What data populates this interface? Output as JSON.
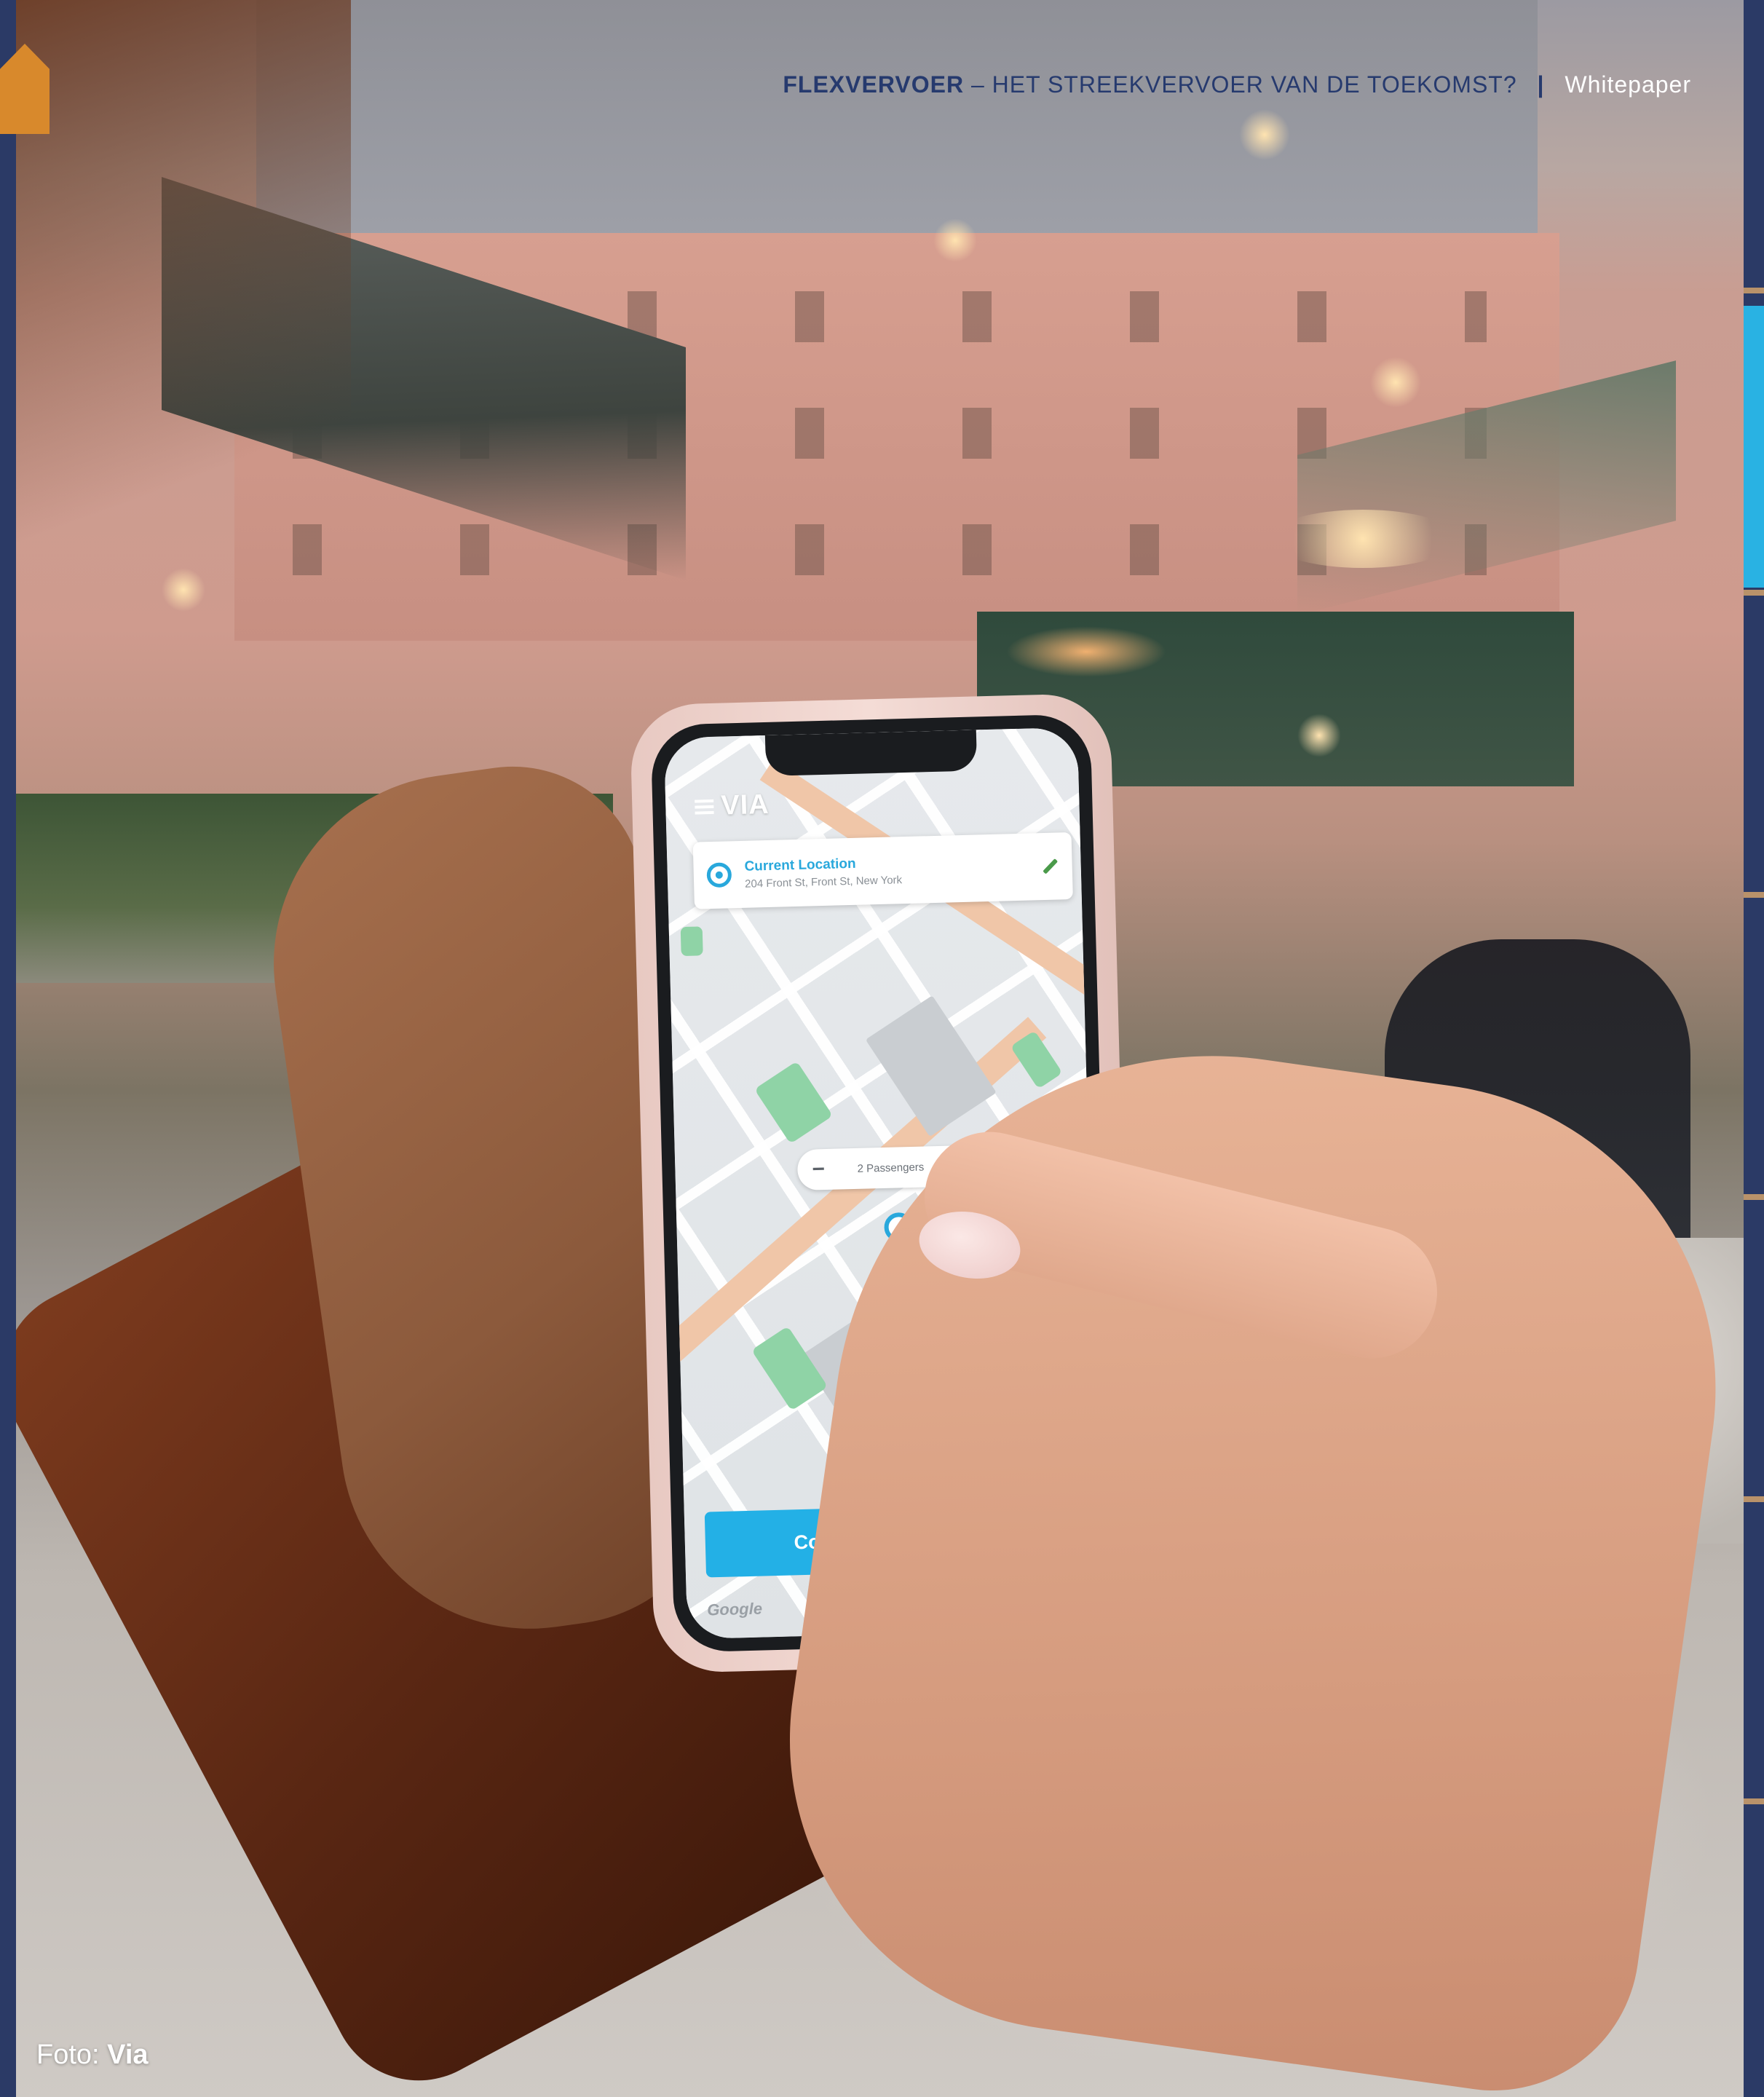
{
  "header": {
    "title_bold": "FLEXVERVOER",
    "title_rest": "– HET STREEKVERVOER VAN DE TOEKOMST?",
    "separator": "|",
    "doc_type": "Whitepaper"
  },
  "photo": {
    "app": {
      "logo": "VIA",
      "location_title": "Current Location",
      "location_address": "204 Front St, Front St, New York",
      "passengers_label": "2 Passengers",
      "minus": "−",
      "plus": "+",
      "confirm_label": "Confirm My Location",
      "map_attribution": "Google",
      "accent_color": "#23b0e6"
    }
  },
  "credit": {
    "prefix": "Foto:",
    "source": "Via"
  },
  "colors": {
    "navy": "#2b3a66",
    "orange": "#d8892c",
    "active_tab": "#29b2e3"
  }
}
